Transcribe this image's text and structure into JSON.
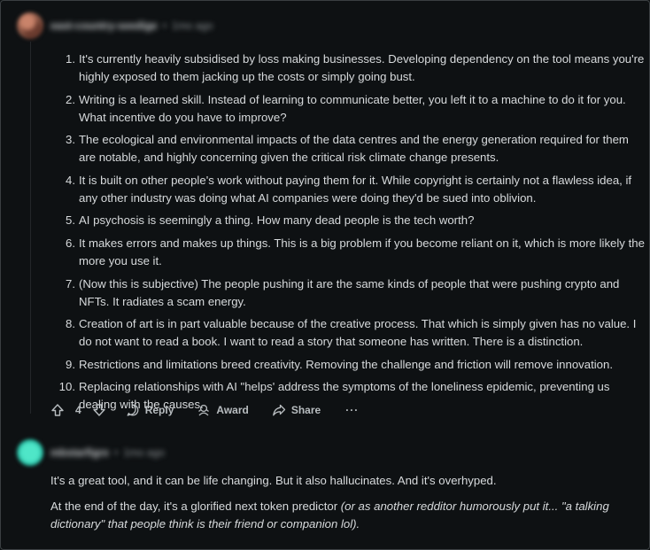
{
  "comment1": {
    "username": "east-country-seedige",
    "separator": "•",
    "time": "1mo ago",
    "points": [
      {
        "num": "1.",
        "text": "It's currently heavily subsidised by loss making businesses. Developing dependency on the tool means you're highly exposed to them jacking up the costs or simply going bust."
      },
      {
        "num": "2.",
        "text": "Writing is a learned skill. Instead of learning to communicate better, you left it to a machine to do it for you. What incentive do you have to improve?"
      },
      {
        "num": "3.",
        "text": "The ecological and environmental impacts of the data centres and the energy generation required for them are notable, and highly concerning given the critical risk climate change presents."
      },
      {
        "num": "4.",
        "text": "It is built on other people's work without paying them for it. While copyright is certainly not a flawless idea, if any other industry was doing what AI companies were doing they'd be sued into oblivion."
      },
      {
        "num": "5.",
        "text": "AI psychosis is seemingly a thing. How many dead people is the tech worth?"
      },
      {
        "num": "6.",
        "text": "It makes errors and makes up things. This is a big problem if you become reliant on it, which is more likely the more you use it."
      },
      {
        "num": "7.",
        "text": "(Now this is subjective) The people pushing it are the same kinds of people that were pushing crypto and NFTs. It radiates a scam energy."
      },
      {
        "num": "8.",
        "text": "Creation of art is in part valuable because of the creative process. That which is simply given has no value. I do not want to read a book. I want to read a story that someone has written. There is a distinction."
      },
      {
        "num": "9.",
        "text": "Restrictions and limitations breed creativity. Removing the challenge and friction will remove innovation."
      },
      {
        "num": "10.",
        "text": "Replacing relationships with AI \"helps' address the symptoms of the loneliness epidemic, preventing us dealing with the causes."
      }
    ],
    "actions": {
      "vote_count": "4",
      "reply": "Reply",
      "award": "Award",
      "share": "Share",
      "more": "···"
    },
    "icons": [
      "upvote-icon",
      "downvote-icon",
      "reply-icon",
      "award-icon",
      "share-icon",
      "more-icon"
    ]
  },
  "comment2": {
    "username": "mbstarfigre",
    "separator": "•",
    "time": "1mo ago",
    "paragraph1": "It's a great tool, and it can be life changing. But it also hallucinates. And it's overhyped.",
    "paragraph2_plain": "At the end of the day, it's a glorified next token predictor ",
    "paragraph2_italic": "(or as another redditor humorously put it... \"a talking dictionary\" that people think is their friend or companion lol).",
    "avatar_color": "#2fd1b2"
  },
  "colors": {
    "background": "#0e1113",
    "text": "#d7dadc",
    "action_text": "#b8bdc0",
    "border": "#3a3f42"
  }
}
